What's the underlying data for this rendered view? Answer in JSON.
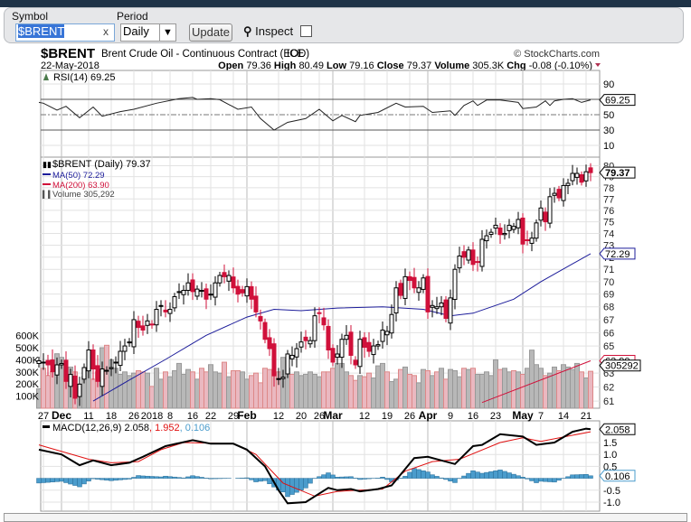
{
  "form": {
    "symbol_label": "Symbol",
    "symbol_value": "$BRENT",
    "clear": "x",
    "period_label": "Period",
    "period_value": "Daily",
    "update_label": "Update",
    "inspect_label": "Inspect"
  },
  "header": {
    "ticker": "$BRENT",
    "name": "Brent Crude Oil - Continuous Contract (EOD)",
    "exchange": "ICE",
    "copyright": "© StockCharts.com",
    "date": "22-May-2018",
    "open_l": "Open",
    "open": "79.36",
    "high_l": "High",
    "high": "80.49",
    "low_l": "Low",
    "low": "79.16",
    "close_l": "Close",
    "close": "79.37",
    "volume_l": "Volume",
    "volume": "305.3K",
    "chg_l": "Chg",
    "chg": "-0.08 (-0.10%)"
  },
  "chart_data": {
    "type": "candlestick",
    "colors": {
      "up": "#000000",
      "down": "#d0103a",
      "ma50": "#1c1c9a",
      "ma200": "#d0103a",
      "volume_up": "#b8b8b8",
      "volume_down": "#eab8c0",
      "macd": "#000000",
      "signal": "#e01010",
      "histogram": "#4a9ccc"
    },
    "price_scale": "log",
    "ylim": [
      60.5,
      80.8
    ],
    "legend": {
      "price": "$BRENT (Daily) 79.37",
      "ma50": "MA(50) 72.29",
      "ma200": "MA(200) 63.90",
      "volume": "Volume 305,292",
      "rsi": "RSI(14) 69.25",
      "macd": "MACD(12,26,9) 2.058",
      "signal": ", 1.952",
      "hist": ", 0.106"
    },
    "price_ticks": [
      "61",
      "62",
      "63",
      "64",
      "65",
      "66",
      "67",
      "68",
      "69",
      "70",
      "71",
      "72",
      "73",
      "74",
      "75",
      "76",
      "77",
      "78",
      "79",
      "80"
    ],
    "volume_ticks": [
      "100K",
      "200K",
      "300K",
      "400K",
      "500K",
      "600K"
    ],
    "rsi_ticks": [
      "90",
      "50",
      "30",
      "10"
    ],
    "macd_ticks": [
      "1.5",
      "1.0",
      "0.5",
      "-0.5",
      "-1.0"
    ],
    "value_tags": {
      "price": "79.37",
      "ma50": "72.29",
      "ma200": "63.90",
      "volume": "305292",
      "rsi": "69.25",
      "macd": "2.058",
      "hist": "0.106"
    },
    "date_labels": [
      [
        "11-27",
        "27"
      ],
      [
        "12-01",
        "Dec"
      ],
      [
        "12-11",
        "11"
      ],
      [
        "12-18",
        "18"
      ],
      [
        "12-26",
        "26"
      ],
      [
        "01-02",
        "2018"
      ],
      [
        "01-08",
        "8"
      ],
      [
        "01-16",
        "16"
      ],
      [
        "01-22",
        "22"
      ],
      [
        "01-29",
        "29"
      ],
      [
        "02-01",
        "Feb"
      ],
      [
        "02-12",
        "12"
      ],
      [
        "02-20",
        "20"
      ],
      [
        "02-26",
        "26"
      ],
      [
        "03-01",
        "Mar"
      ],
      [
        "03-12",
        "12"
      ],
      [
        "03-19",
        "19"
      ],
      [
        "03-26",
        "26"
      ],
      [
        "04-02",
        "Apr"
      ],
      [
        "04-09",
        "9"
      ],
      [
        "04-16",
        "16"
      ],
      [
        "04-23",
        "23"
      ],
      [
        "05-01",
        "May"
      ],
      [
        "05-07",
        "7"
      ],
      [
        "05-14",
        "14"
      ],
      [
        "05-21",
        "21"
      ]
    ],
    "dates": [
      "11-24",
      "11-27",
      "11-28",
      "11-29",
      "11-30",
      "12-01",
      "12-04",
      "12-05",
      "12-06",
      "12-07",
      "12-08",
      "12-11",
      "12-12",
      "12-13",
      "12-14",
      "12-15",
      "12-18",
      "12-19",
      "12-20",
      "12-21",
      "12-22",
      "12-26",
      "12-27",
      "12-28",
      "12-29",
      "01-02",
      "01-03",
      "01-04",
      "01-05",
      "01-08",
      "01-09",
      "01-10",
      "01-11",
      "01-12",
      "01-16",
      "01-17",
      "01-18",
      "01-19",
      "01-22",
      "01-23",
      "01-24",
      "01-25",
      "01-26",
      "01-29",
      "01-30",
      "01-31",
      "02-01",
      "02-02",
      "02-05",
      "02-06",
      "02-07",
      "02-08",
      "02-09",
      "02-12",
      "02-13",
      "02-14",
      "02-15",
      "02-16",
      "02-20",
      "02-21",
      "02-22",
      "02-23",
      "02-26",
      "02-27",
      "02-28",
      "03-01",
      "03-02",
      "03-05",
      "03-06",
      "03-07",
      "03-08",
      "03-09",
      "03-12",
      "03-13",
      "03-14",
      "03-15",
      "03-16",
      "03-19",
      "03-20",
      "03-21",
      "03-22",
      "03-23",
      "03-26",
      "03-27",
      "03-28",
      "03-29",
      "04-02",
      "04-03",
      "04-04",
      "04-05",
      "04-06",
      "04-09",
      "04-10",
      "04-11",
      "04-12",
      "04-13",
      "04-16",
      "04-17",
      "04-18",
      "04-19",
      "04-20",
      "04-23",
      "04-24",
      "04-25",
      "04-26",
      "04-27",
      "04-30",
      "05-01",
      "05-02",
      "05-03",
      "05-04",
      "05-07",
      "05-08",
      "05-09",
      "05-10",
      "05-11",
      "05-14",
      "05-15",
      "05-16",
      "05-17",
      "05-18",
      "05-21",
      "05-22"
    ],
    "close": [
      63.9,
      63.8,
      63.6,
      63.1,
      63.6,
      63.7,
      62.4,
      62.9,
      61.2,
      62.2,
      63.4,
      64.7,
      63.3,
      62.4,
      63.3,
      63.2,
      63.4,
      63.8,
      64.6,
      65.0,
      65.3,
      67.0,
      66.4,
      66.2,
      66.9,
      66.6,
      67.8,
      68.1,
      67.6,
      67.8,
      68.8,
      69.2,
      69.3,
      69.9,
      69.2,
      69.4,
      69.3,
      68.6,
      69.0,
      69.9,
      70.5,
      70.4,
      70.5,
      69.5,
      69.0,
      69.1,
      69.6,
      68.6,
      67.6,
      66.9,
      65.5,
      64.8,
      62.8,
      62.6,
      62.7,
      64.4,
      64.3,
      64.8,
      65.3,
      65.4,
      65.4,
      67.3,
      67.5,
      66.6,
      64.7,
      63.8,
      64.4,
      65.5,
      65.8,
      64.3,
      63.6,
      65.5,
      64.9,
      64.6,
      65.0,
      65.1,
      66.2,
      66.1,
      67.4,
      69.5,
      68.9,
      70.4,
      70.1,
      69.5,
      69.5,
      70.3,
      67.6,
      68.1,
      68.0,
      68.3,
      67.1,
      68.7,
      71.0,
      72.1,
      72.0,
      72.6,
      71.4,
      71.6,
      73.5,
      73.8,
      74.1,
      74.7,
      73.9,
      74.0,
      74.7,
      74.6,
      75.2,
      73.1,
      73.4,
      73.6,
      74.9,
      76.2,
      75.0,
      77.2,
      77.5,
      77.1,
      78.2,
      78.4,
      79.3,
      79.3,
      78.5,
      79.45,
      79.37
    ],
    "volume_k": [
      160,
      330,
      270,
      300,
      450,
      420,
      250,
      340,
      300,
      200,
      260,
      320,
      240,
      300,
      500,
      520,
      400,
      330,
      280,
      300,
      270,
      290,
      310,
      300,
      290,
      180,
      330,
      240,
      300,
      260,
      310,
      370,
      280,
      320,
      300,
      240,
      330,
      300,
      360,
      300,
      290,
      380,
      260,
      310,
      310,
      300,
      240,
      270,
      290,
      210,
      330,
      320,
      270,
      300,
      420,
      330,
      280,
      300,
      270,
      280,
      300,
      280,
      260,
      300,
      300,
      330,
      370,
      370,
      300,
      270,
      230,
      270,
      260,
      290,
      250,
      350,
      370,
      300,
      220,
      240,
      320,
      340,
      280,
      270,
      210,
      320,
      310,
      270,
      300,
      330,
      240,
      320,
      310,
      260,
      330,
      320,
      330,
      280,
      280,
      300,
      270,
      400,
      320,
      330,
      300,
      310,
      300,
      280,
      330,
      480,
      360,
      330,
      270,
      290,
      340,
      310,
      360,
      340,
      320,
      370,
      300,
      250,
      305
    ],
    "ma50": [
      [
        "12-12",
        61.0
      ],
      [
        "12-22",
        62.5
      ],
      [
        "01-05",
        64.0
      ],
      [
        "01-19",
        65.8
      ],
      [
        "02-01",
        67.2
      ],
      [
        "02-09",
        67.8
      ],
      [
        "02-20",
        67.7
      ],
      [
        "03-02",
        67.9
      ],
      [
        "03-16",
        68.0
      ],
      [
        "03-29",
        67.8
      ],
      [
        "04-09",
        67.3
      ],
      [
        "04-16",
        67.5
      ],
      [
        "04-27",
        68.6
      ],
      [
        "05-07",
        70.0
      ],
      [
        "05-22",
        72.29
      ]
    ],
    "ma200": [
      [
        "04-18",
        60.9
      ],
      [
        "05-22",
        63.9
      ]
    ],
    "rsi": [
      [
        "11-24",
        66
      ],
      [
        "11-27",
        65
      ],
      [
        "11-30",
        56
      ],
      [
        "12-04",
        61
      ],
      [
        "12-07",
        46
      ],
      [
        "12-12",
        60
      ],
      [
        "12-14",
        48
      ],
      [
        "12-20",
        54
      ],
      [
        "12-26",
        57
      ],
      [
        "01-03",
        65
      ],
      [
        "01-10",
        71
      ],
      [
        "01-16",
        72.5
      ],
      [
        "01-17",
        70
      ],
      [
        "01-22",
        71
      ],
      [
        "01-24",
        69.5
      ],
      [
        "01-30",
        57
      ],
      [
        "02-02",
        60
      ],
      [
        "02-06",
        45
      ],
      [
        "02-09",
        30
      ],
      [
        "02-14",
        40
      ],
      [
        "02-21",
        45
      ],
      [
        "02-26",
        57
      ],
      [
        "03-01",
        42
      ],
      [
        "03-05",
        49
      ],
      [
        "03-08",
        41
      ],
      [
        "03-09",
        49
      ],
      [
        "03-15",
        53
      ],
      [
        "03-21",
        65
      ],
      [
        "03-23",
        60
      ],
      [
        "03-29",
        61
      ],
      [
        "04-03",
        53
      ],
      [
        "04-09",
        55
      ],
      [
        "04-10",
        49
      ],
      [
        "04-12",
        62
      ],
      [
        "04-16",
        68
      ],
      [
        "04-17",
        62
      ],
      [
        "04-19",
        69
      ],
      [
        "04-24",
        69
      ],
      [
        "04-30",
        66
      ],
      [
        "05-01",
        58
      ],
      [
        "05-04",
        60
      ],
      [
        "05-08",
        68
      ],
      [
        "05-09",
        62
      ],
      [
        "05-10",
        68
      ],
      [
        "05-14",
        70
      ],
      [
        "05-16",
        71
      ],
      [
        "05-18",
        66
      ],
      [
        "05-22",
        69.25
      ]
    ],
    "macd": [
      [
        "11-24",
        1.2
      ],
      [
        "12-01",
        1.0
      ],
      [
        "12-07",
        0.55
      ],
      [
        "12-12",
        0.75
      ],
      [
        "12-18",
        0.55
      ],
      [
        "12-22",
        0.65
      ],
      [
        "12-28",
        0.9
      ],
      [
        "01-05",
        1.35
      ],
      [
        "01-16",
        1.6
      ],
      [
        "01-22",
        1.45
      ],
      [
        "01-29",
        1.45
      ],
      [
        "02-01",
        1.2
      ],
      [
        "02-07",
        0.5
      ],
      [
        "02-12",
        -0.5
      ],
      [
        "02-14",
        -1.05
      ],
      [
        "02-21",
        -1.0
      ],
      [
        "02-28",
        -0.4
      ],
      [
        "03-02",
        -0.5
      ],
      [
        "03-07",
        -0.45
      ],
      [
        "03-09",
        -0.55
      ],
      [
        "03-15",
        -0.45
      ],
      [
        "03-20",
        -0.3
      ],
      [
        "03-27",
        0.85
      ],
      [
        "04-02",
        0.9
      ],
      [
        "04-05",
        0.75
      ],
      [
        "04-10",
        0.6
      ],
      [
        "04-16",
        1.35
      ],
      [
        "04-18",
        1.4
      ],
      [
        "04-24",
        1.85
      ],
      [
        "05-01",
        1.75
      ],
      [
        "05-04",
        1.4
      ],
      [
        "05-10",
        1.5
      ],
      [
        "05-16",
        1.95
      ],
      [
        "05-21",
        2.08
      ],
      [
        "05-22",
        2.058
      ]
    ],
    "signal": [
      [
        "11-24",
        1.4
      ],
      [
        "12-11",
        0.8
      ],
      [
        "12-18",
        0.65
      ],
      [
        "12-27",
        0.7
      ],
      [
        "01-04",
        1.2
      ],
      [
        "01-11",
        1.5
      ],
      [
        "01-29",
        1.45
      ],
      [
        "02-05",
        1.0
      ],
      [
        "02-13",
        -0.2
      ],
      [
        "02-23",
        -0.75
      ],
      [
        "03-02",
        -0.55
      ],
      [
        "03-16",
        -0.45
      ],
      [
        "03-23",
        0.3
      ],
      [
        "04-03",
        0.7
      ],
      [
        "04-11",
        0.8
      ],
      [
        "04-24",
        1.5
      ],
      [
        "05-01",
        1.7
      ],
      [
        "05-07",
        1.55
      ],
      [
        "05-22",
        1.952
      ]
    ]
  }
}
